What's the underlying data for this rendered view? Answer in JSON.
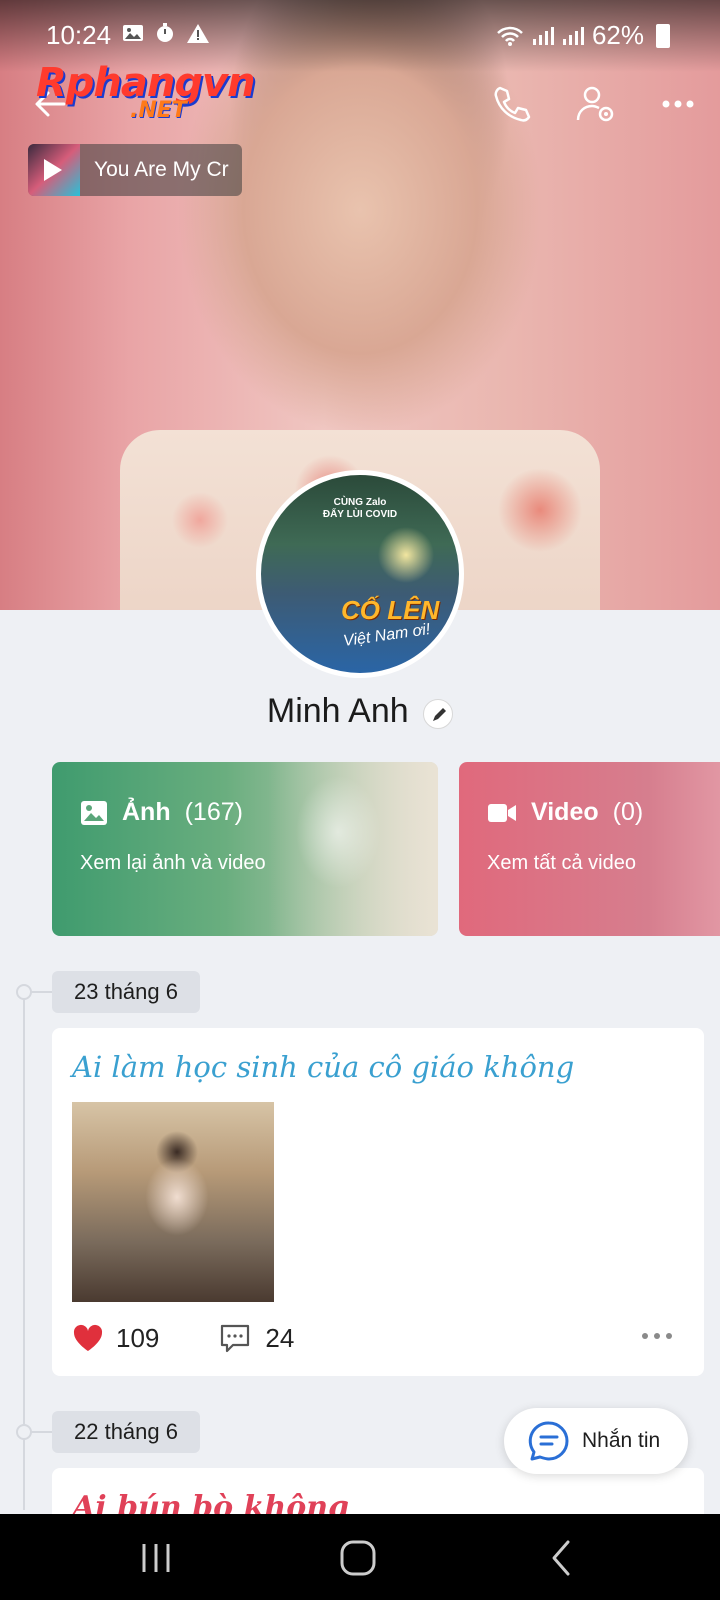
{
  "status_bar": {
    "time": "10:24",
    "battery": "62%"
  },
  "watermark": {
    "logo_main": "Rphangvn",
    "logo_sub": ".NET"
  },
  "music": {
    "title": "You Are My Cr"
  },
  "avatar": {
    "line1": "CÙNG Zalo",
    "line2": "ĐẨY LÙI COVID",
    "big_text": "CỐ LÊN",
    "small_text": "Việt Nam ơi!"
  },
  "profile": {
    "name": "Minh Anh"
  },
  "media_cards": {
    "photos": {
      "title": "Ảnh",
      "count": "(167)",
      "subtitle": "Xem lại ảnh và video"
    },
    "videos": {
      "title": "Video",
      "count": "(0)",
      "subtitle": "Xem tất cả video"
    }
  },
  "timeline": [
    {
      "date": "23 tháng 6",
      "title": "Ai làm học sinh của cô giáo không",
      "likes": "109",
      "comments": "24"
    },
    {
      "date": "22 tháng 6",
      "title": "Ai bún bò không"
    }
  ],
  "message_button": {
    "label": "Nhắn tin"
  },
  "colors": {
    "photos_card": "#3f9b6e",
    "videos_card": "#e0697c",
    "like": "#e0303c",
    "post_title_blue": "#3aa0d0",
    "post_title_red": "#e04158",
    "accent": "#2a6fd6"
  },
  "icons": [
    "back-arrow-icon",
    "phone-icon",
    "user-settings-icon",
    "more-icon",
    "play-icon",
    "edit-icon",
    "image-icon",
    "video-camera-icon",
    "heart-icon",
    "comment-icon",
    "chat-icon",
    "recent-apps-icon",
    "home-icon",
    "nav-back-icon"
  ]
}
